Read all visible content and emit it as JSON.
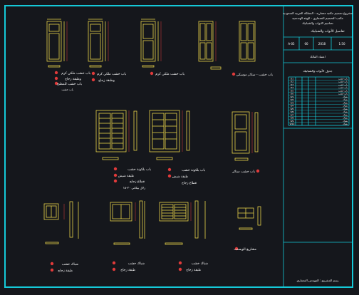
{
  "drawing": {
    "title_block": {
      "header_lines": [
        "مشروع تصميم مكتبة معمارية - المملكة العربية السعودية",
        "مكتب التصميم المعماري - الهيئة الهندسية",
        "تصاميم الابواب والشبابيك"
      ],
      "sheet_title": "تفاصيل الأبواب والشبابيك",
      "sheet_no": "A-05",
      "rev": "00",
      "date": "2018",
      "scale": "1:50",
      "stamp_text": "اعتماد المالك",
      "footer": "رسم المشروع : المهندس المعماري"
    },
    "schedule": {
      "title": "جدول الأبواب والشبابيك",
      "rows": [
        {
          "code": "D1",
          "desc": "باب خشب"
        },
        {
          "code": "D2",
          "desc": "باب خشب"
        },
        {
          "code": "D3",
          "desc": "باب خشب"
        },
        {
          "code": "D4",
          "desc": "باب خشب"
        },
        {
          "code": "D5",
          "desc": "باب خشب"
        },
        {
          "code": "D6",
          "desc": "باب خشب"
        },
        {
          "code": "W1",
          "desc": "شباك"
        },
        {
          "code": "W2",
          "desc": "شباك"
        },
        {
          "code": "W3",
          "desc": "شباك"
        },
        {
          "code": "W4",
          "desc": "شباك"
        },
        {
          "code": "W5",
          "desc": "شباك"
        },
        {
          "code": "W6",
          "desc": "شباك"
        },
        {
          "code": "W7",
          "desc": "شباك"
        },
        {
          "code": "W8",
          "desc": "شباك"
        },
        {
          "code": "W9",
          "desc": "شباك"
        },
        {
          "code": "W10",
          "desc": "شباك"
        }
      ]
    },
    "labels": {
      "d1_a": "باب خشب ملكي كرم",
      "d1_b": "وطبقة زجاج",
      "d1_c": "باب خشب للمطبخ",
      "d1_d": "باب خشب",
      "d2_a": "باب خشب ملكي كرم",
      "d2_b": "وطبقة زجاج",
      "d3_a": "باب خشب ملكي كرم",
      "d4_a": "باب خشب - ستائر موسكي",
      "d5_a": "باب بلكونة خشب",
      "d5_b": "طبقة شيش",
      "d5_c": "قطاع زجاج",
      "d5_d": "زلال بيكاني ٢٠-١٨",
      "d6_a": "باب بلكونة خشب",
      "d6_b": "طبقة شيش",
      "d6_c": "قطاع زجاج",
      "d7_a": "باب خشب ستائر",
      "w1_a": "شباك خشب",
      "w1_b": "طبقة زجاج",
      "w2_a": "شباك خشب",
      "w2_b": "طبقة زجاج",
      "w3_a": "شباك خشب",
      "w3_b": "طبقة زجاج",
      "w4_a": "مشاريع الويسنت"
    },
    "colors": {
      "background": "#15171c",
      "frame": "#15c9d8",
      "line": "#e8d44a",
      "text": "#ffffff",
      "marker": "#e03a3a"
    }
  }
}
